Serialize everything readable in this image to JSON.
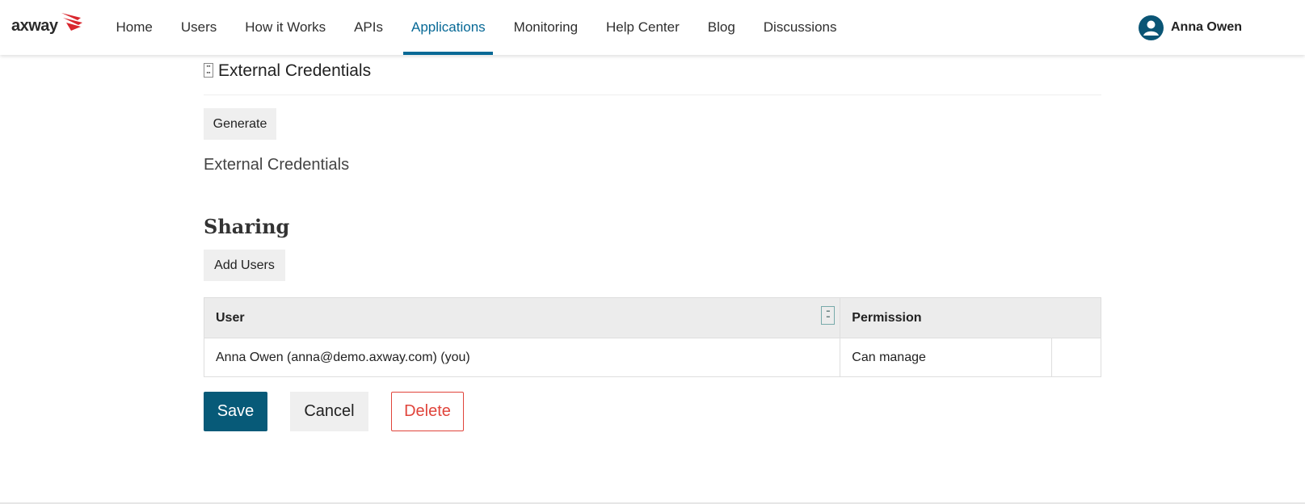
{
  "header": {
    "logo_text": "axway",
    "nav": [
      {
        "label": "Home"
      },
      {
        "label": "Users"
      },
      {
        "label": "How it Works"
      },
      {
        "label": "APIs"
      },
      {
        "label": "Applications",
        "active": true
      },
      {
        "label": "Monitoring"
      },
      {
        "label": "Help Center"
      },
      {
        "label": "Blog"
      },
      {
        "label": "Discussions"
      }
    ],
    "user_name": "Anna Owen"
  },
  "colors": {
    "accent": "#076996",
    "primary_button": "#075a78",
    "danger": "#e0443b",
    "logo_red": "#d9262e"
  },
  "external_credentials": {
    "section_title": "External Credentials",
    "generate_label": "Generate",
    "list_label": "External Credentials"
  },
  "sharing": {
    "title": "Sharing",
    "add_users_label": "Add Users",
    "columns": [
      "User",
      "Permission"
    ],
    "rows": [
      {
        "user": "Anna Owen (anna@demo.axway.com) (you)",
        "permission": "Can manage"
      }
    ]
  },
  "actions": {
    "save": "Save",
    "cancel": "Cancel",
    "delete": "Delete"
  }
}
